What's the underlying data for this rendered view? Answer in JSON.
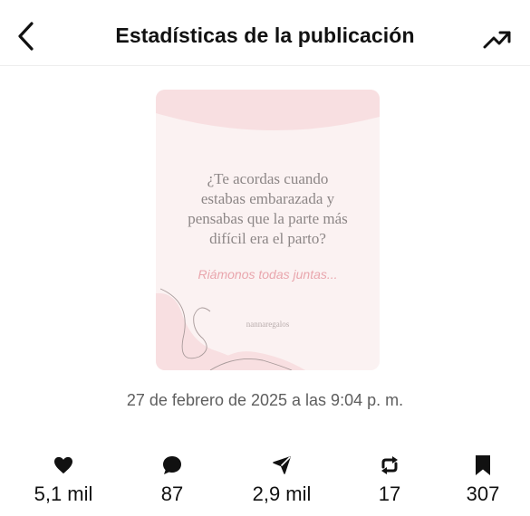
{
  "header": {
    "title": "Estadísticas de la publicación",
    "back_icon": "chevron-left-icon",
    "trend_icon": "trending-up-icon"
  },
  "post": {
    "question_lines": [
      "¿Te acordas cuando",
      "estabas embarazada y",
      "pensabas que la parte más",
      "difícil era el parto?"
    ],
    "subtitle": "Riámonos todas juntas...",
    "handle": "nannaregalos",
    "colors": {
      "background": "#fbf2f2",
      "band": "#f8dfe1",
      "accent": "#e9a6ad"
    }
  },
  "timestamp": "27 de febrero de 2025 a las 9:04 p. m.",
  "stats": [
    {
      "icon": "heart-icon",
      "value": "5,1 mil"
    },
    {
      "icon": "comment-icon",
      "value": "87"
    },
    {
      "icon": "share-icon",
      "value": "2,9 mil"
    },
    {
      "icon": "repost-icon",
      "value": "17"
    },
    {
      "icon": "bookmark-icon",
      "value": "307"
    }
  ]
}
